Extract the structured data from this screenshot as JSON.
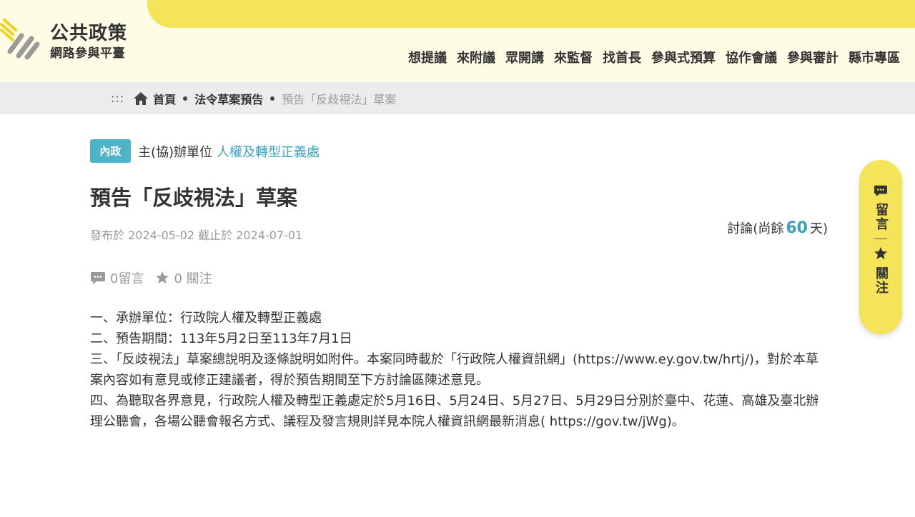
{
  "header": {
    "logo_title": "公共政策",
    "logo_subtitle": "網路參與平臺",
    "nav": [
      "想提議",
      "來附議",
      "眾開講",
      "來監督",
      "找首長",
      "參與式預算",
      "協作會議",
      "參與審計",
      "縣市專區"
    ]
  },
  "breadcrumb": {
    "separator": ":::",
    "home": "首頁",
    "section": "法令草案預告",
    "current": "預告「反歧視法」草案"
  },
  "main": {
    "category_tag": "內政",
    "agency_label": "主(協)辦單位",
    "agency_name": "人權及轉型正義處",
    "title": "預告「反歧視法」草案",
    "dates": "發布於 2024-05-02 截止於 2024-07-01",
    "discussion_prefix": "討論(尚餘",
    "discussion_days": "60",
    "discussion_suffix": "天)",
    "comments": "0留言",
    "follows": "0 關注",
    "content": [
      "一、承辦單位：行政院人權及轉型正義處",
      "二、預告期間：113年5月2日至113年7月1日",
      "三、「反歧視法」草案總說明及逐條說明如附件。本案同時載於「行政院人權資訊網」(https://www.ey.gov.tw/hrtj/)，對於本草案內容如有意見或修正建議者，得於預告期間至下方討論區陳述意見。",
      "四、為聽取各界意見，行政院人權及轉型正義處定於5月16日、5月24日、5月27日、5月29日分別於臺中、花蓮、高雄及臺北辦理公聽會，各場公聽會報名方式、議程及發言規則詳見本院人權資訊網最新消息( https://gov.tw/jWg)。"
    ]
  },
  "side_panel": {
    "comment_label": "留言",
    "follow_label": "關注"
  },
  "colors": {
    "brand_yellow": "#f5e35a",
    "header_bg": "#fffce6",
    "accent_teal": "#38a3bd",
    "tag_teal": "#4eb3c9"
  },
  "icons": [
    "logo-icon",
    "home-icon",
    "comment-icon",
    "star-icon"
  ]
}
